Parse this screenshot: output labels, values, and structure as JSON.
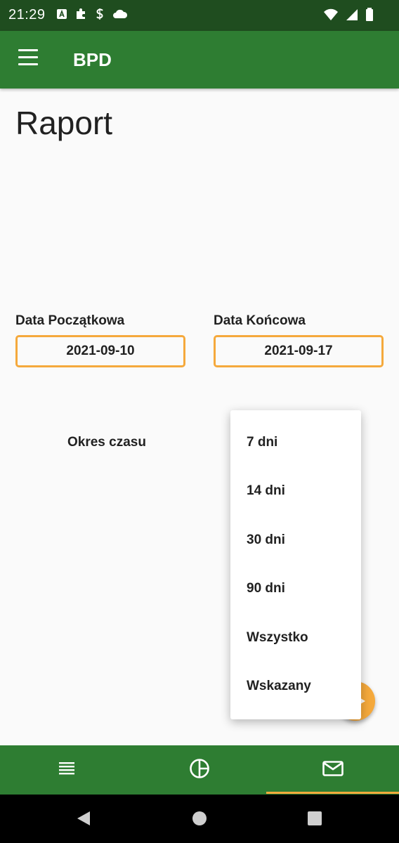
{
  "status_bar": {
    "time": "21:29",
    "left_icons": [
      "a-badge-icon",
      "puzzle-icon",
      "s-icon",
      "cloud-icon"
    ],
    "right_icons": [
      "wifi-icon",
      "signal-icon",
      "battery-icon"
    ]
  },
  "app_bar": {
    "title": "BPD",
    "menu_icon": "hamburger-menu-icon",
    "background": "#2e7d32"
  },
  "page": {
    "title": "Raport"
  },
  "start_date": {
    "label": "Data Początkowa",
    "value": "2021-09-10"
  },
  "end_date": {
    "label": "Data Końcowa",
    "value": "2021-09-17"
  },
  "period": {
    "label": "Okres czasu",
    "options": [
      "7 dni",
      "14 dni",
      "30 dni",
      "90 dni",
      "Wszystko",
      "Wskazany"
    ]
  },
  "fab": {
    "icon": "arrow-right-icon",
    "color": "#f5a93c"
  },
  "bottom_nav": {
    "tabs": [
      {
        "icon": "list-icon"
      },
      {
        "icon": "pie-chart-icon"
      },
      {
        "icon": "mail-icon",
        "active": true
      }
    ],
    "accent": "#f5a93c"
  },
  "system_nav": {
    "icons": [
      "back-icon",
      "home-icon",
      "recents-icon"
    ]
  }
}
